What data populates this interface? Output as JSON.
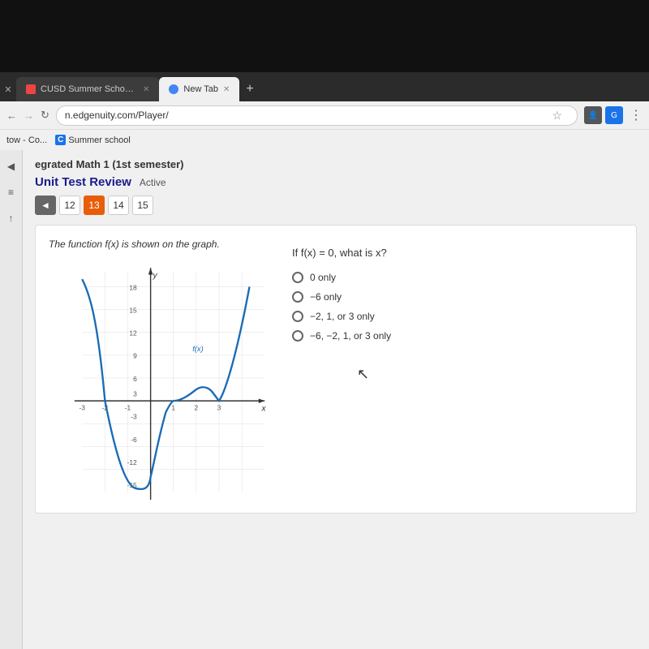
{
  "darkTop": {
    "height": 185
  },
  "browser": {
    "tabs": [
      {
        "id": "tab1",
        "favicon": "x",
        "label": "CUSD Summer School Integrate...",
        "active": false,
        "closable": true
      },
      {
        "id": "tab2",
        "favicon": "chrome",
        "label": "New Tab",
        "active": true,
        "closable": true
      }
    ],
    "addressBar": "n.edgenuity.com/Player/",
    "bookmarks": [
      {
        "label": "tow - Co..."
      },
      {
        "label": "Summer school",
        "icon": "C"
      }
    ]
  },
  "page": {
    "courseTitle": "egrated Math 1 (1st semester)",
    "reviewTitle": "Unit Test Review",
    "statusBadge": "Active",
    "pagination": {
      "prevLabel": "◄",
      "pages": [
        "12",
        "13",
        "14",
        "15"
      ],
      "activePage": "13"
    }
  },
  "question": {
    "graphDescription": "The function f(x) is shown on the graph.",
    "questionText": "If f(x) = 0, what is x?",
    "options": [
      {
        "id": "opt1",
        "label": "0 only"
      },
      {
        "id": "opt2",
        "label": "−6 only"
      },
      {
        "id": "opt3",
        "label": "−2, 1, or 3 only"
      },
      {
        "id": "opt4",
        "label": "−6, −2, 1, or 3 only"
      }
    ],
    "graphLabel": "f(x)"
  },
  "sidebar": {
    "icons": [
      "◀",
      "≡",
      "↑"
    ]
  }
}
